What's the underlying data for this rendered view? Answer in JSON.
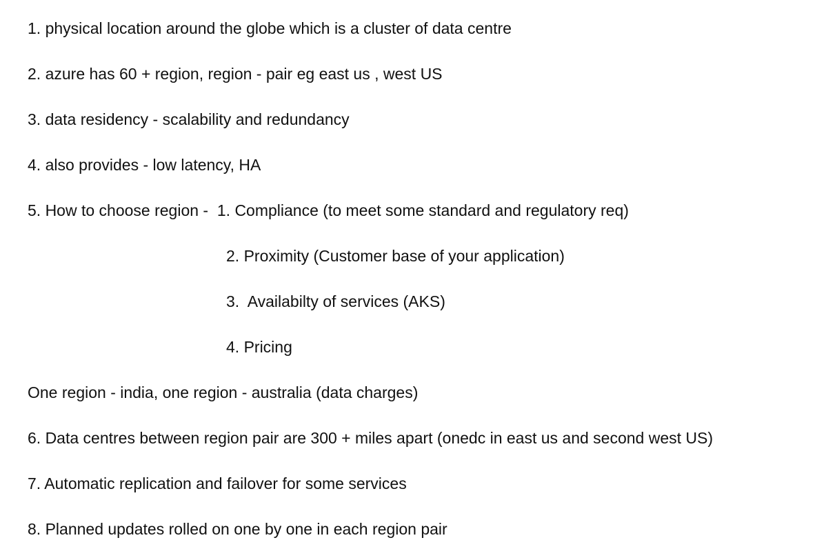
{
  "document": {
    "lines": [
      {
        "text": "1. physical location around the globe which is a cluster of data centre"
      },
      {
        "text": "2. azure has 60 + region, region - pair eg east us , west US"
      },
      {
        "text": "3. data residency - scalability and redundancy"
      },
      {
        "text": "4. also provides - low latency, HA"
      },
      {
        "text": "5. How to choose region -  1. Compliance (to meet some standard and regulatory req)"
      },
      {
        "text": "2. Proximity (Customer base of your application)"
      },
      {
        "text": "3.  Availabilty of services (AKS)"
      },
      {
        "text": "4. Pricing"
      },
      {
        "text": "One region - india, one region - australia (data charges)"
      },
      {
        "text": "6. Data centres between region pair are 300 + miles apart (onedc in east us and second west US)"
      },
      {
        "text": "7. Automatic replication and failover for some services"
      },
      {
        "text": "8. Planned updates rolled on one by one in each region pair"
      }
    ]
  }
}
